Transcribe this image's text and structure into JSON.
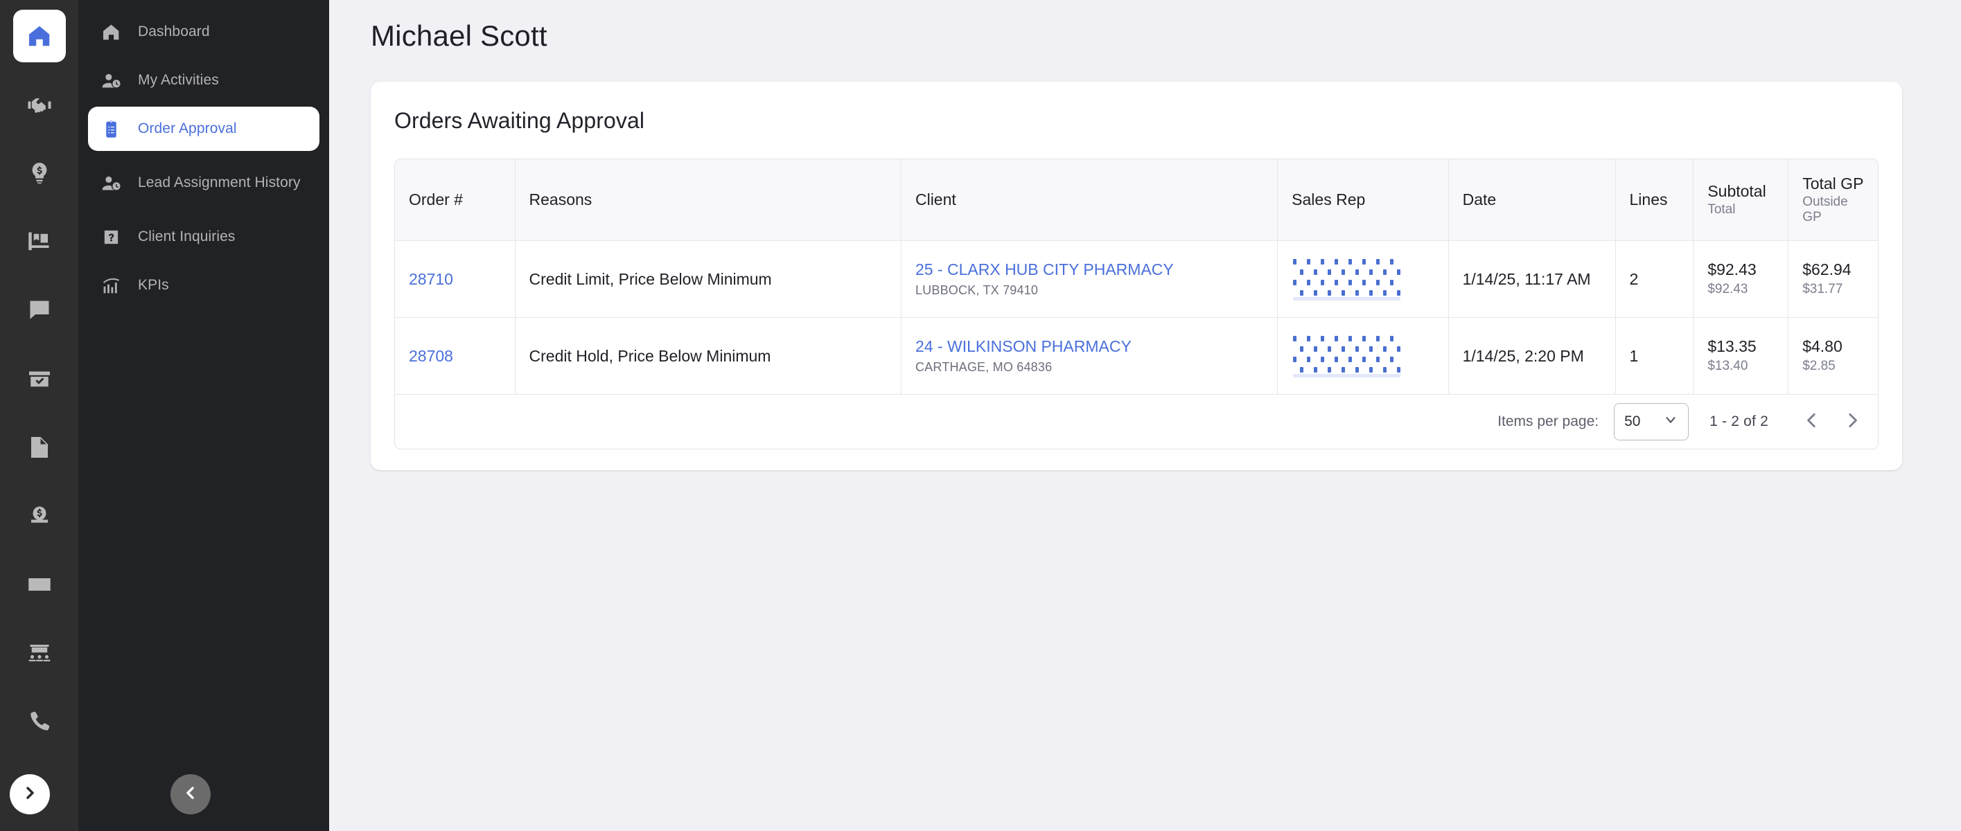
{
  "colors": {
    "accent": "#4a6fdc",
    "rail_bg": "#2e2e2e",
    "nav_bg": "#212225",
    "page_bg": "#f1f1f5",
    "card_bg": "#ffffff",
    "header_bg": "#f8f8fa",
    "muted_text": "#7b7d8c"
  },
  "rail": {
    "items": [
      {
        "icon": "home-icon",
        "active": true
      },
      {
        "icon": "handshake-icon",
        "active": false
      },
      {
        "icon": "lightbulb-dollar-icon",
        "active": false
      },
      {
        "icon": "delivery-cart-icon",
        "active": false
      },
      {
        "icon": "chat-dollar-icon",
        "active": false
      },
      {
        "icon": "box-check-icon",
        "active": false
      },
      {
        "icon": "invoice-dollar-icon",
        "active": false
      },
      {
        "icon": "money-bag-icon",
        "active": false
      },
      {
        "icon": "check-payment-icon",
        "active": false
      },
      {
        "icon": "meeting-room-icon",
        "active": false
      },
      {
        "icon": "phone-icon",
        "active": false
      }
    ],
    "expand_icon": "chevron-right-icon"
  },
  "nav": {
    "items": [
      {
        "label": "Dashboard",
        "icon": "home-icon",
        "active": false
      },
      {
        "label": "My Activities",
        "icon": "person-clock-icon",
        "active": false
      },
      {
        "label": "Order Approval",
        "icon": "clipboard-list-icon",
        "active": true
      },
      {
        "label": "Lead Assignment History",
        "icon": "person-clock-icon",
        "active": false
      },
      {
        "label": "Client Inquiries",
        "icon": "question-box-icon",
        "active": false
      },
      {
        "label": "KPIs",
        "icon": "chart-trend-icon",
        "active": false
      }
    ],
    "collapse_icon": "chevron-left-icon"
  },
  "header": {
    "title": "Michael Scott"
  },
  "card": {
    "title": "Orders Awaiting Approval"
  },
  "table": {
    "columns": [
      {
        "label": "Order #",
        "sub": ""
      },
      {
        "label": "Reasons",
        "sub": ""
      },
      {
        "label": "Client",
        "sub": ""
      },
      {
        "label": "Sales Rep",
        "sub": ""
      },
      {
        "label": "Date",
        "sub": ""
      },
      {
        "label": "Lines",
        "sub": ""
      },
      {
        "label": "Subtotal",
        "sub": "Total"
      },
      {
        "label": "Total GP",
        "sub": "Outside GP"
      }
    ],
    "rows": [
      {
        "order": "28710",
        "reasons": "Credit Limit, Price Below Minimum",
        "client_name": "25 - CLARX HUB CITY PHARMACY",
        "client_addr": "LUBBOCK, TX 79410",
        "sales_rep": "",
        "date": "1/14/25, 11:17 AM",
        "lines": "2",
        "subtotal": "$92.43",
        "total": "$92.43",
        "total_gp": "$62.94",
        "outside_gp": "$31.77"
      },
      {
        "order": "28708",
        "reasons": "Credit Hold, Price Below Minimum",
        "client_name": "24 - WILKINSON PHARMACY",
        "client_addr": "CARTHAGE, MO 64836",
        "sales_rep": "",
        "date": "1/14/25, 2:20 PM",
        "lines": "1",
        "subtotal": "$13.35",
        "total": "$13.40",
        "total_gp": "$4.80",
        "outside_gp": "$2.85"
      }
    ]
  },
  "paginator": {
    "items_per_page_label": "Items per page:",
    "items_per_page_value": "50",
    "range_label": "1 - 2 of 2",
    "prev_icon": "chevron-left-icon",
    "next_icon": "chevron-right-icon",
    "dropdown_icon": "chevron-down-icon"
  }
}
